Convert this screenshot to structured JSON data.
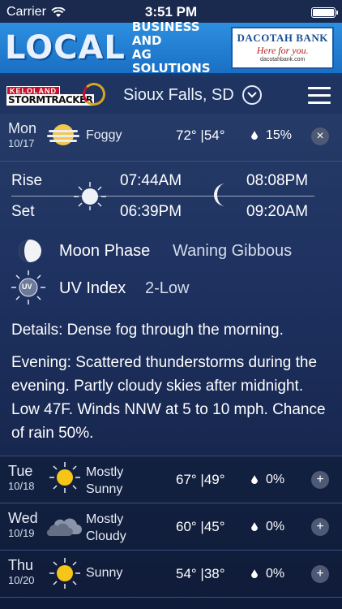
{
  "status": {
    "carrier": "Carrier",
    "time": "3:51 PM"
  },
  "ad": {
    "local": "LOCAL",
    "biz_line1": "BUSINESS AND",
    "biz_line2": "AG SOLUTIONS",
    "bank_name": "DACOTAH BANK",
    "bank_tagline": "Here for you.",
    "bank_url": "dacotahbank.com"
  },
  "header": {
    "logo_top": "KELOLAND",
    "logo_main": "STORMTRACKER",
    "city": "Sioux Falls, SD"
  },
  "today": {
    "day": "Mon",
    "date": "10/17",
    "condition": "Foggy",
    "temp": "72° |54°",
    "rain": "15%",
    "close": "×",
    "rise_label": "Rise",
    "set_label": "Set",
    "sun_rise": "07:44AM",
    "sun_set": "06:39PM",
    "moon_rise": "08:08PM",
    "moon_set": "09:20AM",
    "moon_phase_label": "Moon Phase",
    "moon_phase": "Waning Gibbous",
    "uv_label": "UV Index",
    "uv_value": "2-Low",
    "uv_icon_text": "UV",
    "details": "Details: Dense fog through the morning.",
    "evening": "Evening: Scattered thunderstorms during the evening. Partly cloudy skies after midnight. Low 47F. Winds NNW at 5 to 10 mph. Chance of rain 50%."
  },
  "forecast": [
    {
      "day": "Tue",
      "date": "10/18",
      "cond1": "Mostly",
      "cond2": "Sunny",
      "temp": "67° |49°",
      "rain": "0%",
      "icon": "sun-icon",
      "expand": "+"
    },
    {
      "day": "Wed",
      "date": "10/19",
      "cond1": "Mostly",
      "cond2": "Cloudy",
      "temp": "60° |45°",
      "rain": "0%",
      "icon": "cloud-icon",
      "expand": "+"
    },
    {
      "day": "Thu",
      "date": "10/20",
      "cond1": "Sunny",
      "cond2": "",
      "temp": "54° |38°",
      "rain": "0%",
      "icon": "sun-icon",
      "expand": "+"
    }
  ],
  "colors": {
    "accent_sun": "#f5c518",
    "background": "#152446",
    "ad_blue": "#2d8fe0"
  }
}
